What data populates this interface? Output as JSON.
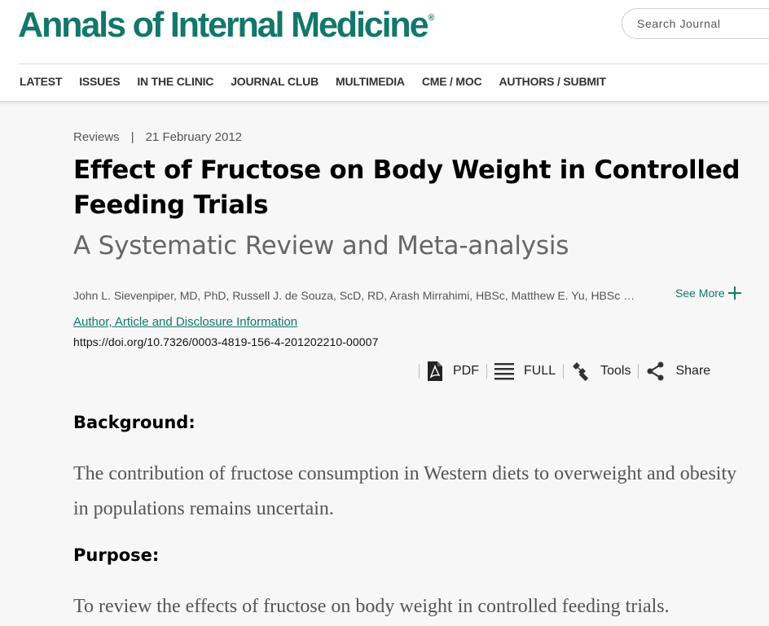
{
  "header": {
    "logo_text": "Annals of Internal Medicine",
    "logo_mark": "®",
    "search_placeholder": "Search Journal",
    "nav": [
      "LATEST",
      "ISSUES",
      "IN THE CLINIC",
      "JOURNAL CLUB",
      "MULTIMEDIA",
      "CME / MOC",
      "AUTHORS / SUBMIT"
    ]
  },
  "article": {
    "type": "Reviews",
    "meta_separator": "|",
    "date": "21 February 2012",
    "title": "Effect of Fructose on Body Weight in Controlled Feeding Trials",
    "subtitle": "A Systematic Review and Meta-analysis",
    "authors": "John L. Sievenpiper, MD, PhD, Russell J. de Souza, ScD, RD, Arash Mirrahimi, HBSc, Matthew E. Yu, HBSc …",
    "see_more": "See More",
    "info_link": "Author, Article and Disclosure Information",
    "doi": "https://doi.org/10.7326/0003-4819-156-4-201202210-00007"
  },
  "toolbar": {
    "pdf": "PDF",
    "full": "FULL",
    "tools": "Tools",
    "share": "Share"
  },
  "abstract": {
    "background_heading": "Background:",
    "background_text": "The contribution of fructose consumption in Western diets to overweight and obesity in populations remains uncertain.",
    "purpose_heading": "Purpose:",
    "purpose_text": "To review the effects of fructose on body weight in controlled feeding trials."
  },
  "colors": {
    "brand": "#13776b",
    "background": "#f7f7f7"
  }
}
